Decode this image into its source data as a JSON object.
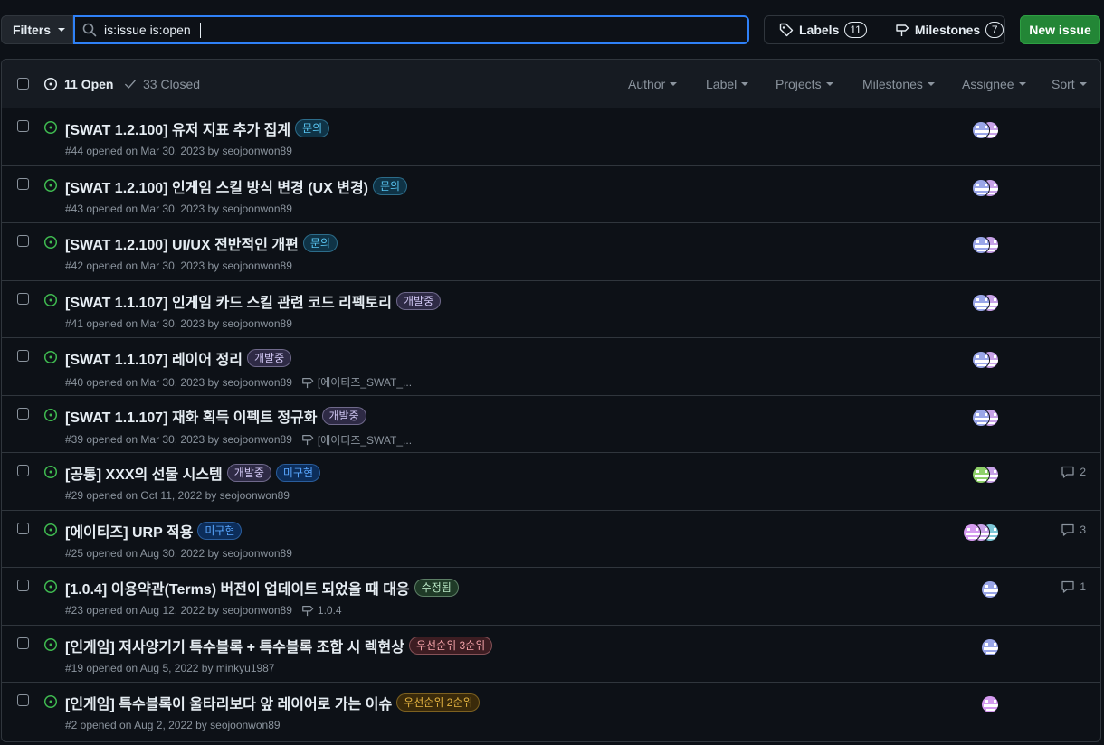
{
  "toolbar": {
    "filters_label": "Filters",
    "search_value": "is:issue is:open",
    "labels_label": "Labels",
    "labels_count": "11",
    "milestones_label": "Milestones",
    "milestones_count": "7",
    "new_issue_label": "New issue"
  },
  "header": {
    "open_label": "11 Open",
    "closed_label": "33 Closed",
    "filters": [
      "Author",
      "Label",
      "Projects",
      "Milestones",
      "Assignee",
      "Sort"
    ]
  },
  "colors": {
    "accent": "#2f81f7",
    "open_green": "#3fb950",
    "new_issue_bg": "#238636"
  },
  "issues": [
    {
      "title": "[SWAT 1.2.100] 유저 지표 추가 집계",
      "labels": [
        {
          "text": "문의",
          "color": "#58c4f0",
          "bg": "#0f3346"
        }
      ],
      "meta": "#44 opened on Mar 30, 2023 by seojoonwon89",
      "milestone": "",
      "avatars": [
        "a",
        "b"
      ],
      "comments": ""
    },
    {
      "title": "[SWAT 1.2.100] 인게임 스킬 방식 변경 (UX 변경)",
      "labels": [
        {
          "text": "문의",
          "color": "#58c4f0",
          "bg": "#0f3346"
        }
      ],
      "meta": "#43 opened on Mar 30, 2023 by seojoonwon89",
      "milestone": "",
      "avatars": [
        "a",
        "b"
      ],
      "comments": ""
    },
    {
      "title": "[SWAT 1.2.100] UI/UX 전반적인 개편",
      "labels": [
        {
          "text": "문의",
          "color": "#58c4f0",
          "bg": "#0f3346"
        }
      ],
      "meta": "#42 opened on Mar 30, 2023 by seojoonwon89",
      "milestone": "",
      "avatars": [
        "a",
        "b"
      ],
      "comments": ""
    },
    {
      "title": "[SWAT 1.1.107] 인게임 카드 스킬 관련 코드 리펙토리",
      "labels": [
        {
          "text": "개발중",
          "color": "#d2c8f5",
          "bg": "#2e2a45"
        }
      ],
      "meta": "#41 opened on Mar 30, 2023 by seojoonwon89",
      "milestone": "",
      "avatars": [
        "a",
        "b"
      ],
      "comments": ""
    },
    {
      "title": "[SWAT 1.1.107] 레이어 정리",
      "labels": [
        {
          "text": "개발중",
          "color": "#d2c8f5",
          "bg": "#2e2a45"
        }
      ],
      "meta": "#40 opened on Mar 30, 2023 by seojoonwon89",
      "milestone": "[에이티즈_SWAT_...",
      "avatars": [
        "a",
        "b"
      ],
      "comments": ""
    },
    {
      "title": "[SWAT 1.1.107] 재화 획득 이펙트 정규화",
      "labels": [
        {
          "text": "개발중",
          "color": "#d2c8f5",
          "bg": "#2e2a45"
        }
      ],
      "meta": "#39 opened on Mar 30, 2023 by seojoonwon89",
      "milestone": "[에이티즈_SWAT_...",
      "avatars": [
        "a",
        "b"
      ],
      "comments": ""
    },
    {
      "title": "[공통] XXX의 선물 시스템",
      "labels": [
        {
          "text": "개발중",
          "color": "#d2c8f5",
          "bg": "#2e2a45"
        },
        {
          "text": "미구현",
          "color": "#58a6ff",
          "bg": "#0c2d5a"
        }
      ],
      "meta": "#29 opened on Oct 11, 2022 by seojoonwon89",
      "milestone": "",
      "avatars": [
        "a",
        "g"
      ],
      "comments": "2"
    },
    {
      "title": "[에이티즈] URP 적용",
      "labels": [
        {
          "text": "미구현",
          "color": "#58a6ff",
          "bg": "#0c2d5a"
        }
      ],
      "meta": "#25 opened on Aug 30, 2022 by seojoonwon89",
      "milestone": "",
      "avatars": [
        "t",
        "a",
        "p"
      ],
      "comments": "3"
    },
    {
      "title": "[1.0.4] 이용약관(Terms) 버전이 업데이트 되었을 때 대응",
      "labels": [
        {
          "text": "수정됨",
          "color": "#b8e6c4",
          "bg": "#1f3a27"
        }
      ],
      "meta": "#23 opened on Aug 12, 2022 by seojoonwon89",
      "milestone": "1.0.4",
      "avatars": [
        "b"
      ],
      "comments": "1"
    },
    {
      "title": "[인게임] 저사양기기 특수블록 + 특수블록 조합 시 렉현상",
      "labels": [
        {
          "text": "우선순위 3순위",
          "color": "#f2a1a8",
          "bg": "#3d1d22"
        }
      ],
      "meta": "#19 opened on Aug 5, 2022 by minkyu1987",
      "milestone": "",
      "avatars": [
        "b"
      ],
      "comments": ""
    },
    {
      "title": "[인게임] 특수블록이 울타리보다 앞 레이어로 가는 이슈",
      "labels": [
        {
          "text": "우선순위 2순위",
          "color": "#e3b341",
          "bg": "#3a2a0a"
        }
      ],
      "meta": "#2 opened on Aug 2, 2022 by seojoonwon89",
      "milestone": "",
      "avatars": [
        "p"
      ],
      "comments": ""
    }
  ]
}
